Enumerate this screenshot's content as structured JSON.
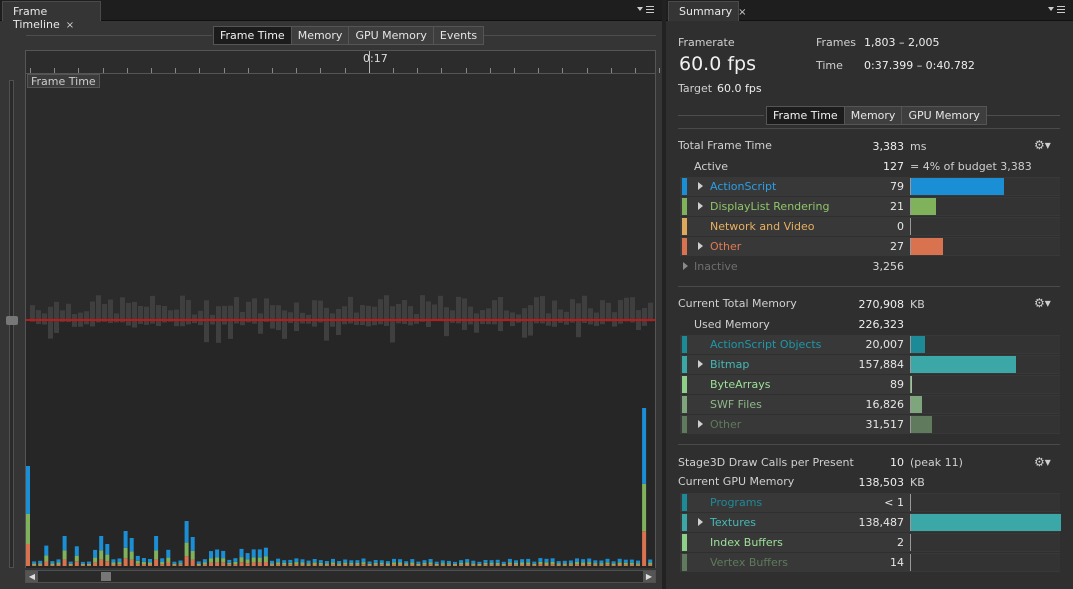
{
  "left_panel": {
    "tab_title": "Frame Timeline",
    "tab_close": "×",
    "seg_tabs": [
      "Frame Time",
      "Memory",
      "GPU Memory",
      "Events"
    ],
    "seg_active": 0,
    "ruler_label": "0:17",
    "chart_label": "Frame Time"
  },
  "right_panel": {
    "tab_title": "Summary",
    "tab_close": "×",
    "framerate_label": "Framerate",
    "framerate_value": "60.0 fps",
    "target_label": "Target",
    "target_value": "60.0 fps",
    "frames_label": "Frames",
    "frames_value": "1,803 – 2,005",
    "time_label": "Time",
    "time_value": "0:37.399 – 0:40.782",
    "seg_tabs": [
      "Frame Time",
      "Memory",
      "GPU Memory"
    ],
    "frame_time": {
      "total_label": "Total Frame Time",
      "total_value": "3,383",
      "total_unit": "ms",
      "active_label": "Active",
      "active_value": "127",
      "active_budget": "=  4%  of budget 3,383",
      "rows": [
        {
          "name": "ActionScript",
          "value": "79",
          "color": "#1b8fd6",
          "name_color": "#2aa0e6",
          "frac": 0.62,
          "expand": true
        },
        {
          "name": "DisplayList Rendering",
          "value": "21",
          "color": "#7fb25a",
          "name_color": "#8fc66a",
          "frac": 0.165,
          "expand": true
        },
        {
          "name": "Network and Video",
          "value": "0",
          "color": "#e0a85a",
          "name_color": "#e8b060",
          "frac": 0,
          "expand": false
        },
        {
          "name": "Other",
          "value": "27",
          "color": "#d9734f",
          "name_color": "#e07a55",
          "frac": 0.215,
          "expand": true
        }
      ],
      "inactive_label": "Inactive",
      "inactive_value": "3,256"
    },
    "memory": {
      "total_label": "Current Total Memory",
      "total_value": "270,908",
      "total_unit": "KB",
      "used_label": "Used Memory",
      "used_value": "226,323",
      "rows": [
        {
          "name": "ActionScript Objects",
          "value": "20,007",
          "color": "#1d8a98",
          "name_color": "#1f98a8",
          "frac": 0.09,
          "expand": false
        },
        {
          "name": "Bitmap",
          "value": "157,884",
          "color": "#3ba7a6",
          "name_color": "#46b8b6",
          "frac": 0.7,
          "expand": true
        },
        {
          "name": "ByteArrays",
          "value": "89",
          "color": "#8ed08a",
          "name_color": "#9ee09a",
          "frac": 0.004,
          "expand": false
        },
        {
          "name": "SWF Files",
          "value": "16,826",
          "color": "#7fa57c",
          "name_color": "#8fb88c",
          "frac": 0.075,
          "expand": false
        },
        {
          "name": "Other",
          "value": "31,517",
          "color": "#5f7a5c",
          "name_color": "#5f7a5c",
          "frac": 0.14,
          "expand": true
        }
      ]
    },
    "gpu": {
      "draw_label": "Stage3D Draw Calls per Present",
      "draw_value": "10",
      "draw_peak": "(peak 11)",
      "total_label": "Current GPU Memory",
      "total_value": "138,503",
      "total_unit": "KB",
      "rows": [
        {
          "name": "Programs",
          "value": "< 1",
          "color": "#1d8a98",
          "name_color": "#1f8a98",
          "frac": 0,
          "expand": false
        },
        {
          "name": "Textures",
          "value": "138,487",
          "color": "#3ba7a6",
          "name_color": "#46b8b6",
          "frac": 1.0,
          "expand": true
        },
        {
          "name": "Index Buffers",
          "value": "2",
          "color": "#8ed08a",
          "name_color": "#9ee09a",
          "frac": 0,
          "expand": false
        },
        {
          "name": "Vertex Buffers",
          "value": "14",
          "color": "#5f7a5c",
          "name_color": "#5f7a5c",
          "frac": 0,
          "expand": false
        }
      ]
    }
  }
}
